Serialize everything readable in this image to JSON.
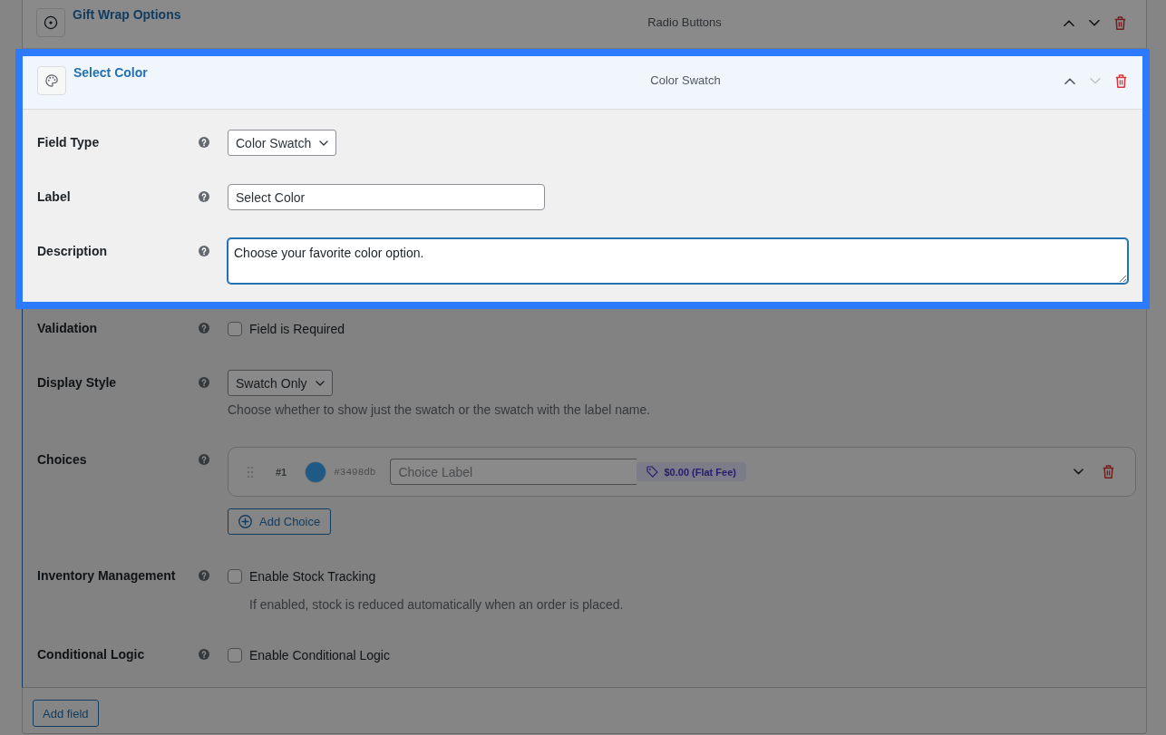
{
  "fields": [
    {
      "kind": "radio",
      "title": "Gift Wrap Options",
      "type": "Radio Buttons",
      "highlighted": false,
      "expanded": false,
      "up_disabled": false,
      "down_disabled": false
    },
    {
      "kind": "color_swatch",
      "title": "Select Color",
      "type": "Color Swatch",
      "highlighted": true,
      "expanded": true,
      "up_disabled": false,
      "down_disabled": true,
      "settings": [
        {
          "kind": "select",
          "label": "Field Type",
          "value": "Color Swatch",
          "highlighted": true
        },
        {
          "kind": "text",
          "label": "Label",
          "value": "Select Color",
          "highlighted": true
        },
        {
          "kind": "textarea",
          "label": "Description",
          "value": "Choose your favorite color option.",
          "focused": true,
          "highlighted": true
        },
        {
          "kind": "checkbox",
          "label": "Validation",
          "option": "Field is Required",
          "checked": false,
          "highlighted": false
        },
        {
          "kind": "select",
          "label": "Display Style",
          "value": "Swatch Only",
          "hint": "Choose whether to show just the swatch or the swatch with the label name.",
          "highlighted": false
        },
        {
          "kind": "choices",
          "label": "Choices",
          "choices": [
            {
              "number": "#1",
              "color": "#1f5a86",
              "hex": "#3498db",
              "placeholder": "Choice Label",
              "price": "$0.00 (Flat Fee)",
              "expanded": false
            }
          ],
          "add_button": "Add Choice",
          "highlighted": false
        },
        {
          "kind": "checkbox",
          "label": "Inventory Management",
          "option": "Enable Stock Tracking",
          "checked": false,
          "hint": "If enabled, stock is reduced automatically when an order is placed.",
          "highlighted": false
        },
        {
          "kind": "checkbox",
          "label": "Conditional Logic",
          "option": "Enable Conditional Logic",
          "checked": false,
          "highlighted": false
        }
      ]
    }
  ],
  "add_field_button": "Add field"
}
